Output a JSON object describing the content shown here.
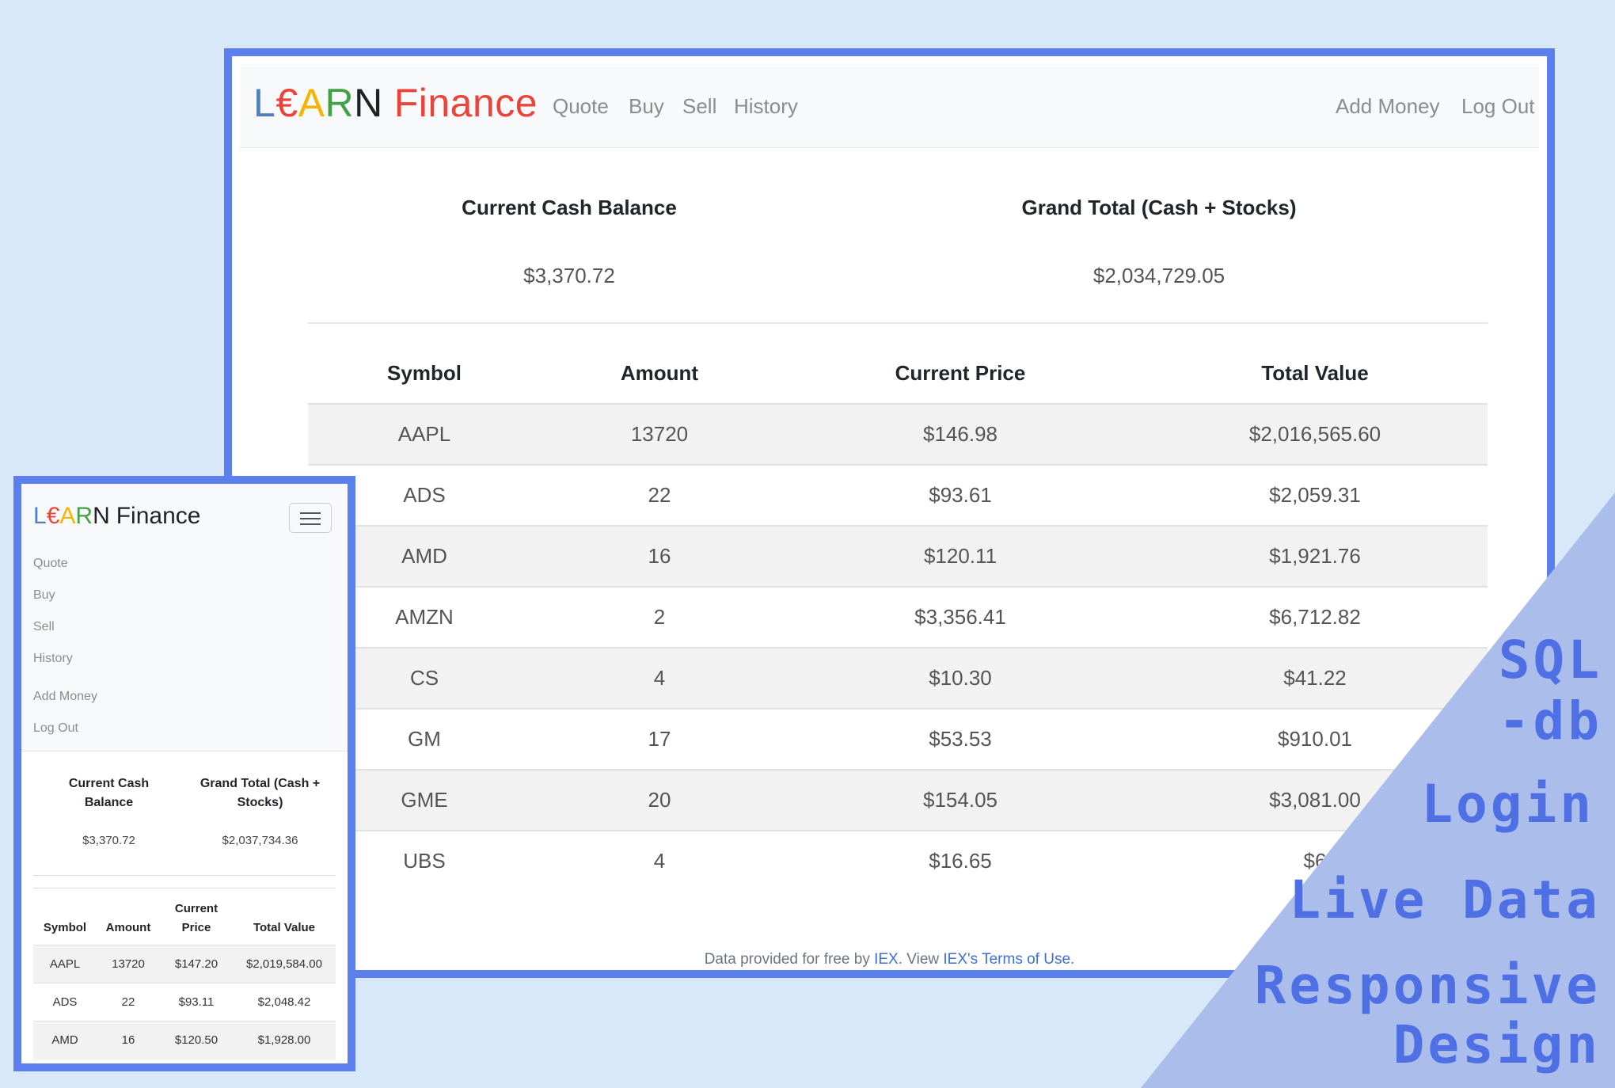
{
  "desktop": {
    "brand": {
      "l": "L",
      "euro": "€",
      "a": "A",
      "r": "R",
      "n": "N",
      "finance": "Finance"
    },
    "nav_left": [
      "Quote",
      "Buy",
      "Sell",
      "History"
    ],
    "nav_right": [
      "Add Money",
      "Log Out"
    ],
    "cash_label": "Current Cash Balance",
    "cash_value": "$3,370.72",
    "total_label": "Grand Total (Cash + Stocks)",
    "total_value": "$2,034,729.05",
    "columns": [
      "Symbol",
      "Amount",
      "Current Price",
      "Total Value"
    ],
    "rows": [
      [
        "AAPL",
        "13720",
        "$146.98",
        "$2,016,565.60"
      ],
      [
        "ADS",
        "22",
        "$93.61",
        "$2,059.31"
      ],
      [
        "AMD",
        "16",
        "$120.11",
        "$1,921.76"
      ],
      [
        "AMZN",
        "2",
        "$3,356.41",
        "$6,712.82"
      ],
      [
        "CS",
        "4",
        "$10.30",
        "$41.22"
      ],
      [
        "GM",
        "17",
        "$53.53",
        "$910.01"
      ],
      [
        "GME",
        "20",
        "$154.05",
        "$3,081.00"
      ],
      [
        "UBS",
        "4",
        "$16.65",
        "$6"
      ]
    ],
    "footer": {
      "prefix": "Data provided for free by ",
      "iex": "IEX",
      "middle": ". View ",
      "terms": "IEX's Terms of Use",
      "suffix": "."
    }
  },
  "mobile": {
    "brand": {
      "l": "L",
      "euro": "€",
      "a": "A",
      "r": "R",
      "n": "N",
      "finance": "Finance"
    },
    "nav": [
      "Quote",
      "Buy",
      "Sell",
      "History",
      "Add Money",
      "Log Out"
    ],
    "cash_label_1": "Current Cash",
    "cash_label_2": "Balance",
    "cash_value": "$3,370.72",
    "total_label_1": "Grand Total (Cash +",
    "total_label_2": "Stocks)",
    "total_value": "$2,037,734.36",
    "columns": [
      "Symbol",
      "Amount",
      "Current",
      "Price",
      "Total Value"
    ],
    "rows": [
      [
        "AAPL",
        "13720",
        "$147.20",
        "$2,019,584.00"
      ],
      [
        "ADS",
        "22",
        "$93.11",
        "$2,048.42"
      ],
      [
        "AMD",
        "16",
        "$120.50",
        "$1,928.00"
      ]
    ]
  },
  "features": [
    "SQL",
    "-db",
    "Login",
    "Live Data",
    "Responsive",
    "Design"
  ],
  "colors": {
    "frame": "#5b7fec",
    "triangle": "#abbdea",
    "feature_text": "#4f70e4",
    "background": "#d9e8f8"
  }
}
